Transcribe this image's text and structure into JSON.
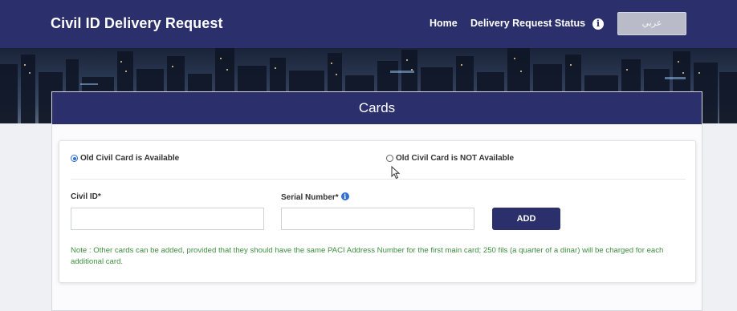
{
  "header": {
    "title": "Civil ID Delivery Request",
    "nav": {
      "home": "Home",
      "status": "Delivery Request Status"
    },
    "info_icon": "i",
    "lang_button": "عربي"
  },
  "panel": {
    "title": "Cards",
    "options": {
      "available": "Old Civil Card is Available",
      "not_available": "Old Civil Card is NOT Available",
      "selected": "available"
    },
    "fields": {
      "civil_id_label": "Civil ID*",
      "civil_id_value": "",
      "serial_label": "Serial Number*",
      "serial_value": ""
    },
    "add_button": "ADD",
    "note": "Note : Other cards can be added, provided that they should have the same PACI Address Number for the first main card; 250 fils (a quarter of a dinar) will be charged for each additional card."
  },
  "colors": {
    "navbar": "#2b2f6b",
    "accent": "#2f6fd6",
    "note_text": "#3f8f3f"
  }
}
